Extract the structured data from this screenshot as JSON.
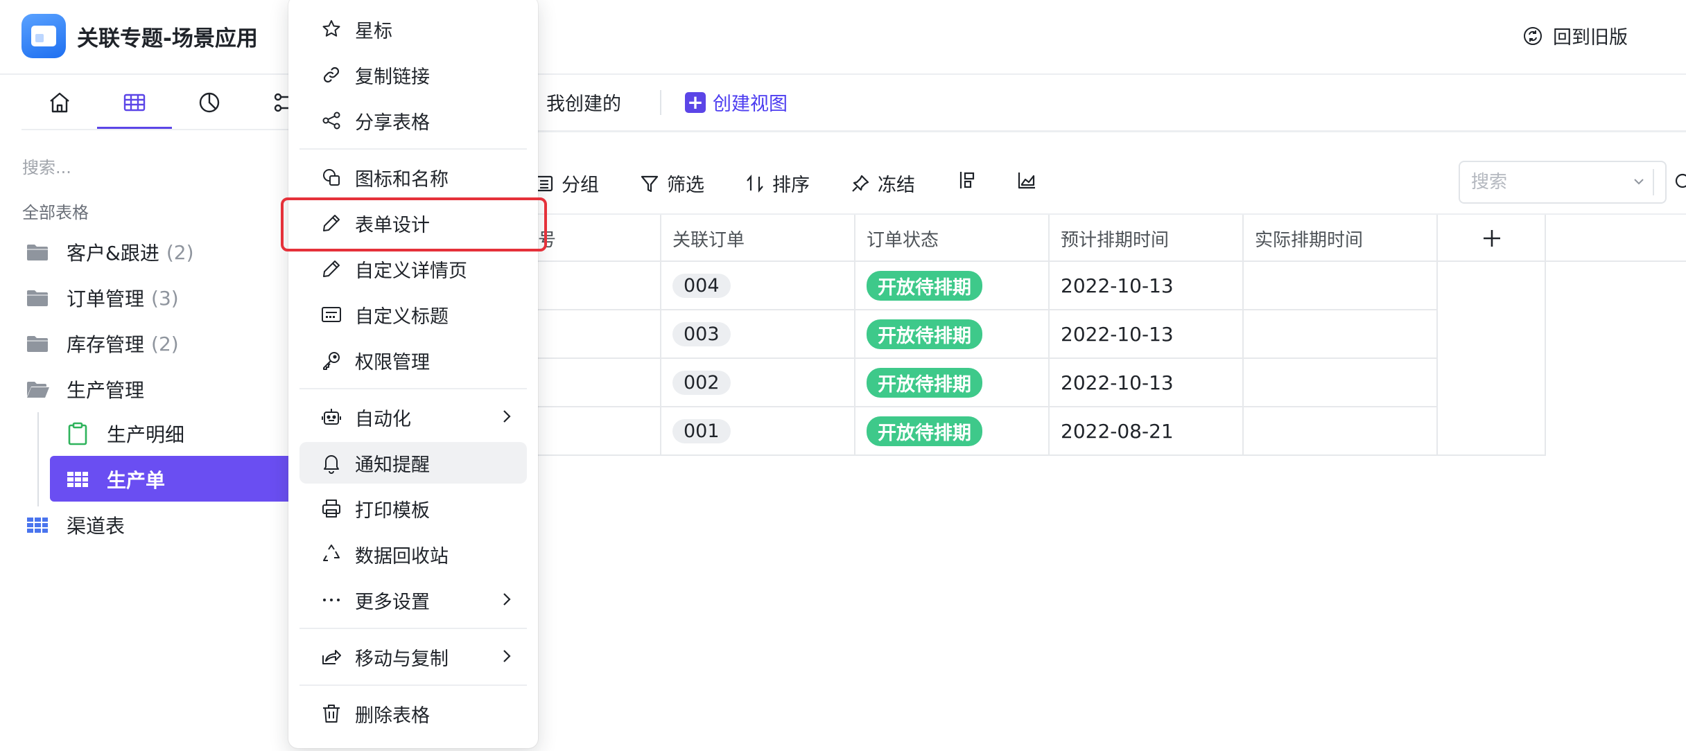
{
  "header": {
    "app_title": "关联专题-场景应用",
    "back_old_version": "回到旧版"
  },
  "sidebar": {
    "search_placeholder": "搜索...",
    "section_label": "全部表格",
    "items": [
      {
        "label": "客户&跟进",
        "count": "(2)",
        "icon": "folder-icon"
      },
      {
        "label": "订单管理",
        "count": "(3)",
        "icon": "folder-icon"
      },
      {
        "label": "库存管理",
        "count": "(2)",
        "icon": "folder-icon"
      },
      {
        "label": "生产管理",
        "count": "",
        "icon": "folder-open-icon"
      },
      {
        "label": "生产明细",
        "count": "",
        "icon": "clipboard-icon"
      },
      {
        "label": "生产单",
        "count": "",
        "icon": "table-icon"
      },
      {
        "label": "渠道表",
        "count": "",
        "icon": "table-icon"
      }
    ]
  },
  "views": {
    "my_created": "我创建的",
    "create_view": "创建视图"
  },
  "toolbar": {
    "group": "分组",
    "filter": "筛选",
    "sort": "排序",
    "freeze": "冻结",
    "search_placeholder": "搜索"
  },
  "table": {
    "partial_header": "号",
    "columns": [
      "关联订单",
      "订单状态",
      "预计排期时间",
      "实际排期时间"
    ],
    "rows": [
      {
        "order": "004",
        "status": "开放待排期",
        "planned": "2022-10-13",
        "actual": ""
      },
      {
        "order": "003",
        "status": "开放待排期",
        "planned": "2022-10-13",
        "actual": ""
      },
      {
        "order": "002",
        "status": "开放待排期",
        "planned": "2022-10-13",
        "actual": ""
      },
      {
        "order": "001",
        "status": "开放待排期",
        "planned": "2022-08-21",
        "actual": ""
      }
    ]
  },
  "menu": {
    "items": [
      {
        "label": "星标",
        "icon": "star-icon"
      },
      {
        "label": "复制链接",
        "icon": "link-icon"
      },
      {
        "label": "分享表格",
        "icon": "share-icon"
      },
      {
        "label": "图标和名称",
        "icon": "shapes-icon"
      },
      {
        "label": "表单设计",
        "icon": "pencil-icon"
      },
      {
        "label": "自定义详情页",
        "icon": "pencil-icon"
      },
      {
        "label": "自定义标题",
        "icon": "title-icon"
      },
      {
        "label": "权限管理",
        "icon": "key-icon"
      },
      {
        "label": "自动化",
        "icon": "robot-icon"
      },
      {
        "label": "通知提醒",
        "icon": "bell-icon"
      },
      {
        "label": "打印模板",
        "icon": "printer-icon"
      },
      {
        "label": "数据回收站",
        "icon": "recycle-icon"
      },
      {
        "label": "更多设置",
        "icon": "more-icon"
      },
      {
        "label": "移动与复制",
        "icon": "move-icon"
      },
      {
        "label": "删除表格",
        "icon": "trash-icon"
      }
    ]
  },
  "colors": {
    "accent": "#5b45e7",
    "status_green": "#3ec98a",
    "highlight_red": "#e5313a"
  }
}
